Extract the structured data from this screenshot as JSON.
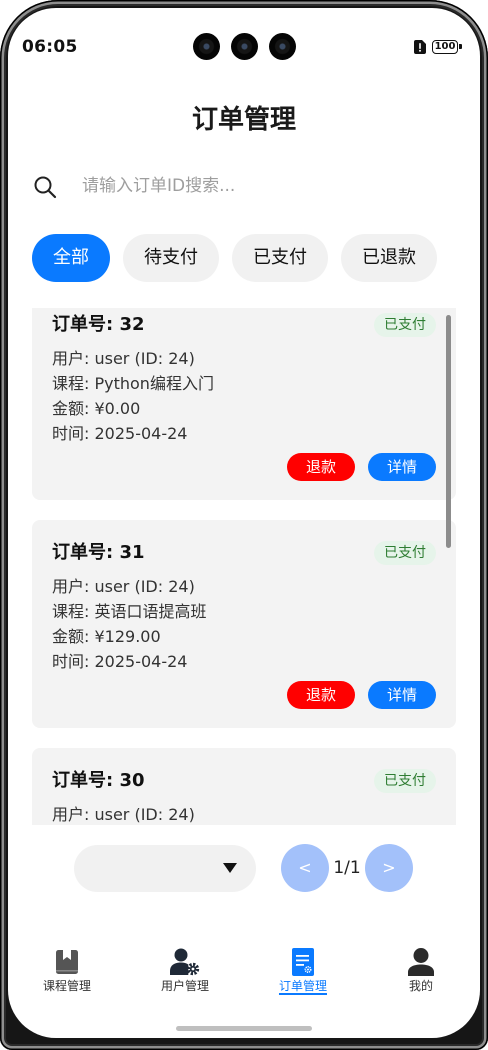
{
  "status_bar": {
    "time": "06:05",
    "battery_level": "100",
    "icons": {
      "sim": "sim-alert-icon",
      "battery": "battery-icon"
    }
  },
  "header": {
    "title": "订单管理"
  },
  "search": {
    "placeholder": "请输入订单ID搜索...",
    "icon": "search-icon"
  },
  "filters": [
    {
      "label": "全部",
      "active": true
    },
    {
      "label": "待支付",
      "active": false
    },
    {
      "label": "已支付",
      "active": false
    },
    {
      "label": "已退款",
      "active": false
    }
  ],
  "orders": [
    {
      "order_no": "订单号: 32",
      "status": "已支付",
      "user": "用户: user (ID: 24)",
      "course": "课程: Python编程入门",
      "amount": "金额: ¥0.00",
      "time": "时间: 2025-04-24",
      "refund_label": "退款",
      "detail_label": "详情"
    },
    {
      "order_no": "订单号: 31",
      "status": "已支付",
      "user": "用户: user (ID: 24)",
      "course": "课程: 英语口语提高班",
      "amount": "金额: ¥129.00",
      "time": "时间: 2025-04-24",
      "refund_label": "退款",
      "detail_label": "详情"
    },
    {
      "order_no": "订单号: 30",
      "status": "已支付",
      "user": "用户: user (ID: 24)"
    }
  ],
  "pagination": {
    "page_size_select": {
      "icon": "dropdown-arrow-icon"
    },
    "prev_label": "<",
    "page_indicator": "1/1",
    "next_label": ">"
  },
  "bottom_nav": [
    {
      "label": "课程管理",
      "icon": "book-icon",
      "active": false
    },
    {
      "label": "用户管理",
      "icon": "user-settings-icon",
      "active": false
    },
    {
      "label": "订单管理",
      "icon": "order-document-icon",
      "active": true
    },
    {
      "label": "我的",
      "icon": "person-icon",
      "active": false
    }
  ],
  "colors": {
    "accent": "#0A7AFF",
    "danger": "#FF0000",
    "badge_bg": "#E6F4EA",
    "badge_text": "#2E7D32",
    "pager_button": "#A3C1FA",
    "card_bg": "#F3F3F3",
    "chip_bg": "#F1F1F1"
  }
}
